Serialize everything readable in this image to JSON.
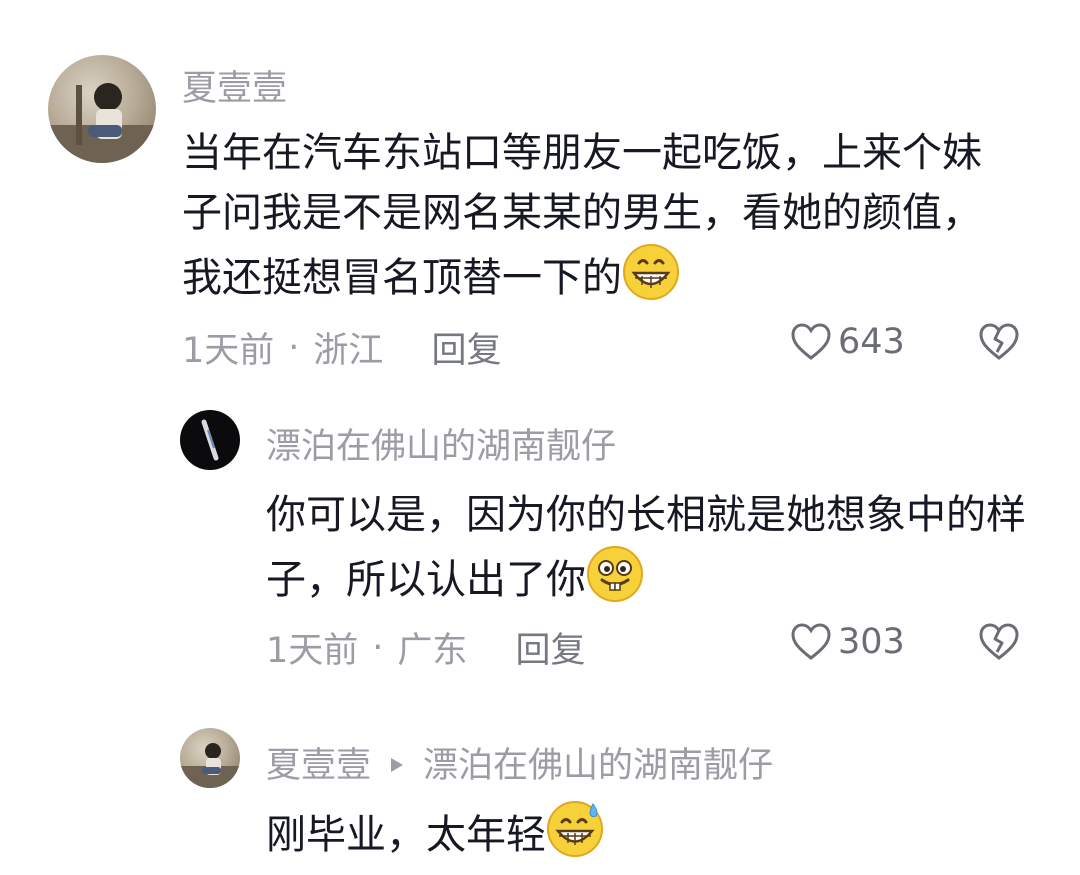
{
  "comments": [
    {
      "username": "夏壹壹",
      "text": "当年在汽车东站口等朋友一起吃饭，上来个妹子问我是不是网名某某的男生，看她的颜值，我还挺想冒名顶替一下的",
      "time": "1天前",
      "location": "浙江",
      "reply_label": "回复",
      "likes": "643",
      "emoji_icon": "grinning-face-icon"
    },
    {
      "username": "漂泊在佛山的湖南靓仔",
      "text": "你可以是，因为你的长相就是她想象中的样子，所以认出了你",
      "time": "1天前",
      "location": "广东",
      "reply_label": "回复",
      "likes": "303",
      "emoji_icon": "buck-tooth-face-icon"
    },
    {
      "username": "夏壹壹",
      "reply_to": "漂泊在佛山的湖南靓仔",
      "text": "刚毕业，太年轻",
      "emoji_icon": "sweat-grin-face-icon"
    }
  ],
  "meta_separator": "·",
  "colors": {
    "text": "#161823",
    "secondary": "#9c9da4",
    "emoji_yellow": "#f7d13a"
  }
}
